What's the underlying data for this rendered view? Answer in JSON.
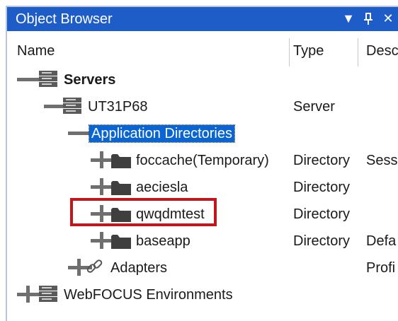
{
  "panel": {
    "title": "Object Browser",
    "buttons": {
      "dropdown_icon": "triangle-down",
      "pin_icon": "pin",
      "close_icon": "x"
    }
  },
  "columns": {
    "name": "Name",
    "type": "Type",
    "description": "Descr"
  },
  "tree": [
    {
      "label": "Servers",
      "type": "",
      "description": "",
      "level": 0,
      "icon": "server-icon",
      "bold": true
    },
    {
      "label": "UT31P68",
      "type": "Server",
      "description": "",
      "level": 1,
      "icon": "server-icon",
      "bold": false
    },
    {
      "label": "Application Directories",
      "type": "",
      "description": "",
      "level": 2,
      "icon": "none",
      "bold": false,
      "selected": true
    },
    {
      "label": "foccache(Temporary)",
      "type": "Directory",
      "description": "Sessi",
      "level": 3,
      "icon": "folder-icon",
      "bold": false
    },
    {
      "label": "aeciesla",
      "type": "Directory",
      "description": "",
      "level": 3,
      "icon": "folder-icon",
      "bold": false
    },
    {
      "label": "qwqdmtest",
      "type": "Directory",
      "description": "",
      "level": 3,
      "icon": "folder-icon",
      "bold": false,
      "highlighted": true
    },
    {
      "label": "baseapp",
      "type": "Directory",
      "description": "Defa",
      "level": 3,
      "icon": "folder-icon",
      "bold": false
    },
    {
      "label": "Adapters",
      "type": "",
      "description": "Profi",
      "level": 2,
      "icon": "link-icon",
      "bold": false
    },
    {
      "label": "WebFOCUS Environments",
      "type": "",
      "description": "",
      "level": 0,
      "icon": "server-icon",
      "bold": false
    }
  ],
  "colors": {
    "titlebar": "#1e5cc8",
    "selection": "#0a64d2",
    "highlight_box": "#c0161c"
  }
}
